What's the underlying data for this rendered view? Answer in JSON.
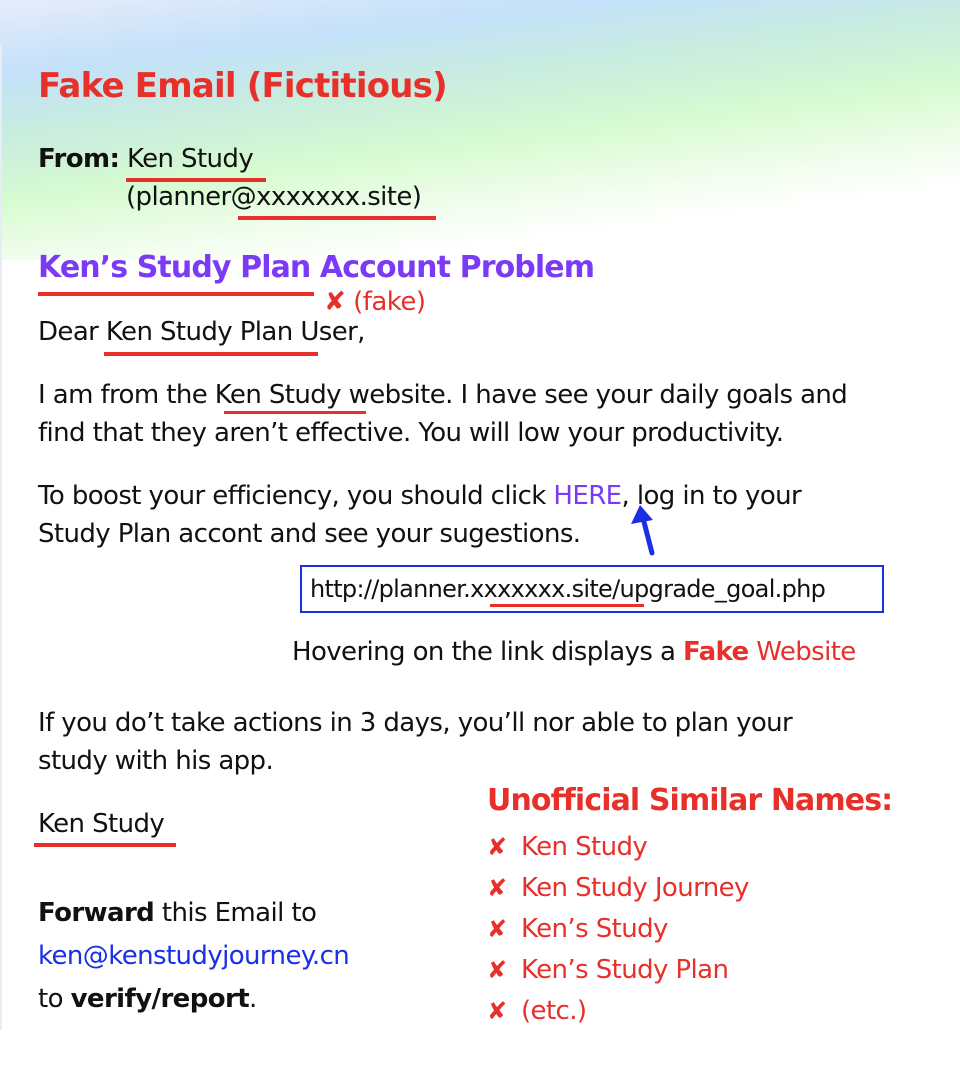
{
  "title": "Fake Email (Fictitious)",
  "from": {
    "label": "From:",
    "name": "Ken Study",
    "address_prefix": "(planner",
    "address_domain": "@xxxxxxx.site",
    "address_suffix": ")"
  },
  "subject": {
    "underlined": "Ken’s Study Plan",
    "rest": " Account Problem",
    "fake_mark": "✘",
    "fake_label": "(fake)"
  },
  "greeting": {
    "prefix": "Dear ",
    "underlined": "Ken Study Plan",
    "suffix": " User,"
  },
  "paragraph1": {
    "line1_prefix": "I am from the ",
    "line1_underlined": "Ken Study",
    "line1_suffix": " website. I have see your daily goals and",
    "line2": "find that they aren’t effective. You will low your productivity."
  },
  "paragraph2": {
    "line1_prefix": "To boost your efficiency, you should click ",
    "link_text": "HERE",
    "line1_suffix": ", log in to your",
    "line2": "Study Plan accont and see your sugestions."
  },
  "hover_url": {
    "prefix": "http://planner.",
    "underlined": "xxxxxxx.site",
    "suffix": "/upgrade_goal.php"
  },
  "hover_caption": {
    "prefix": "Hovering on the link displays a ",
    "bold": "Fake",
    "suffix": " Website"
  },
  "paragraph3": {
    "line1": "If you do’t take actions in 3 days, you’ll nor able to plan your",
    "line2": "study with his app."
  },
  "signature": "Ken Study",
  "forward": {
    "bold1": "Forward",
    "text1": " this Email to",
    "email": "ken@kenstudyjourney.cn",
    "text2": "to ",
    "bold2": "verify/report",
    "text3": "."
  },
  "similar_names": {
    "title": "Unofficial Similar Names:",
    "mark": "✘",
    "items": [
      "Ken Study",
      "Ken Study Journey",
      "Ken’s Study",
      "Ken’s Study Plan",
      "(etc.)"
    ]
  },
  "colors": {
    "warning_red": "#e8302a",
    "subject_purple": "#7b3af5",
    "link_blue": "#1a2fe6"
  }
}
